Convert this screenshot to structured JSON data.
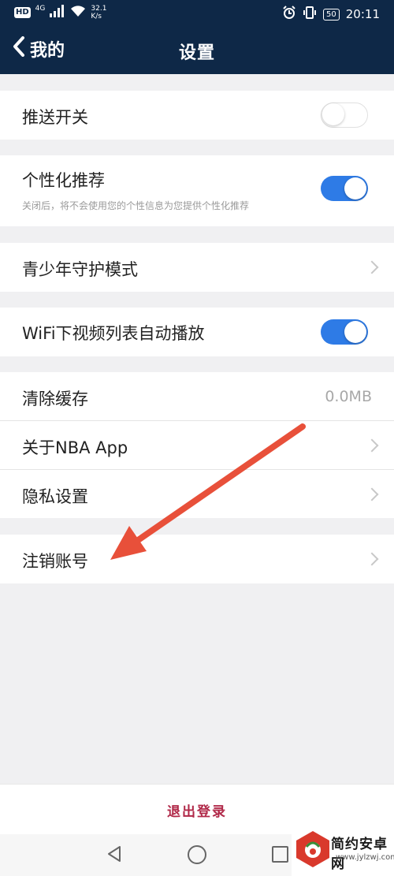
{
  "status_bar": {
    "hd": "HD",
    "network": "4G",
    "speed_value": "32.1",
    "speed_unit": "K/s",
    "battery": "50",
    "time": "20:11"
  },
  "header": {
    "back_label": "我的",
    "title": "设置"
  },
  "settings": {
    "push": {
      "label": "推送开关",
      "enabled": false
    },
    "personal": {
      "label": "个性化推荐",
      "desc": "关闭后，将不会使用您的个性信息为您提供个性化推荐",
      "enabled": true
    },
    "youth": {
      "label": "青少年守护模式"
    },
    "wifi_autoplay": {
      "label": "WiFi下视频列表自动播放",
      "enabled": true
    },
    "cache": {
      "label": "清除缓存",
      "value": "0.0MB"
    },
    "about": {
      "label": "关于NBA App"
    },
    "privacy": {
      "label": "隐私设置"
    },
    "cancel_account": {
      "label": "注销账号"
    }
  },
  "logout": {
    "label": "退出登录"
  },
  "watermark": {
    "name": "简约安卓网",
    "url": "www.jylzwj.com"
  },
  "colors": {
    "header_bg": "#0e2847",
    "toggle_on": "#2e7be6",
    "logout_text": "#b02848",
    "arrow": "#e8503a"
  }
}
